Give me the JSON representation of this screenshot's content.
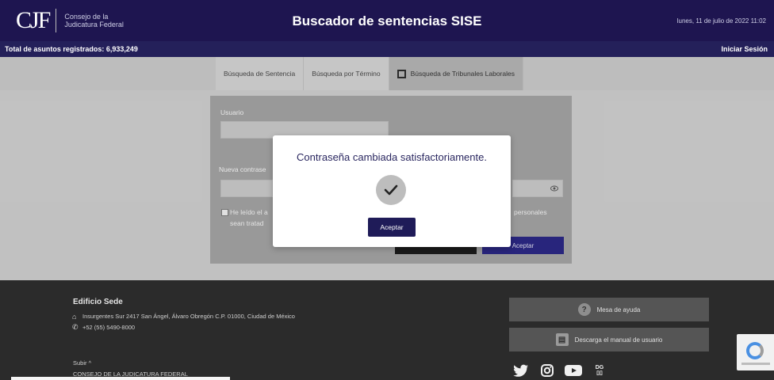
{
  "header": {
    "logo_mark": "CJF",
    "logo_text_line1": "Consejo de la",
    "logo_text_line2": "Judicatura Federal",
    "title": "Buscador de sentencias SISE",
    "date": "lunes, 11 de julio de 2022 11:02"
  },
  "subbar": {
    "total": "Total de asuntos registrados: 6,933,249",
    "login": "Iniciar Sesión"
  },
  "tabs": [
    {
      "label": "Búsqueda de Sentencia"
    },
    {
      "label": "Búsqueda por Término"
    },
    {
      "label": "Búsqueda de Tribunales Laborales"
    }
  ],
  "form": {
    "usuario_label": "Usuario",
    "password_label": "Nueva contrase",
    "consent_text_a": "He leído el a",
    "consent_text_a2": "sean tratad",
    "consent_text_b": "personales",
    "submit_label": "Aceptar"
  },
  "modal": {
    "message": "Contraseña cambiada satisfactoriamente.",
    "button_label": "Aceptar"
  },
  "footer": {
    "building_title": "Edificio Sede",
    "address": "Insurgentes Sur 2417 San Ángel, Álvaro Obregón C.P. 01000, Ciudad de México",
    "phone": "+52 (55) 5490-8000",
    "up_label": "Subir ^",
    "org_link": "CONSEJO DE LA JUDICATURA FEDERAL",
    "help_button": "Mesa de ayuda",
    "manual_button": "Descarga el manual de usuario"
  },
  "colors": {
    "header_bg": "#1e1550",
    "accent": "#1f1b58",
    "footer_bg": "#2b2b2b"
  },
  "icons": [
    "external-link-icon",
    "eye-icon",
    "check-icon",
    "home-icon",
    "phone-icon",
    "help-icon",
    "document-icon",
    "twitter-icon",
    "instagram-icon",
    "youtube-icon",
    "dg-icon",
    "recaptcha-icon"
  ]
}
